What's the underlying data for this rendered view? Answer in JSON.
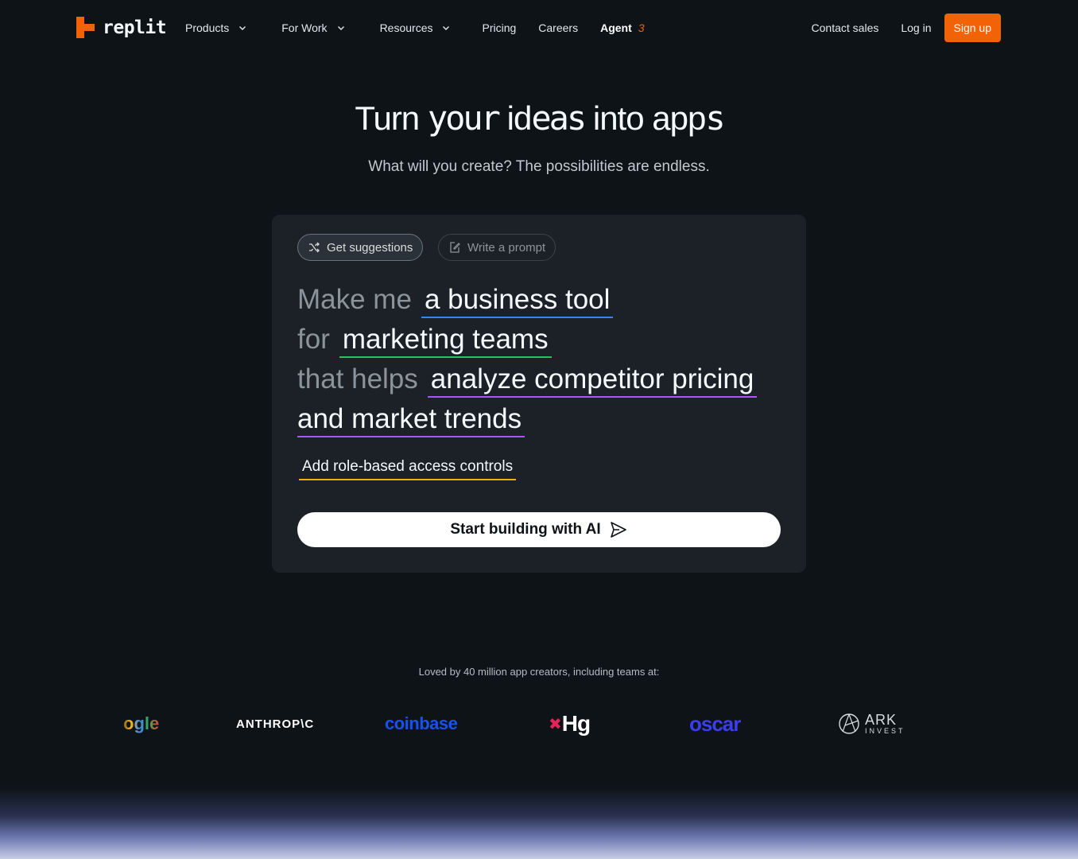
{
  "nav": {
    "logo_text": "replit",
    "brand_color": "#f26207",
    "items": [
      {
        "label": "Products",
        "dropdown": true
      },
      {
        "label": "For Work",
        "dropdown": true
      },
      {
        "label": "Resources",
        "dropdown": true
      },
      {
        "label": "Pricing",
        "dropdown": false
      },
      {
        "label": "Careers",
        "dropdown": false
      }
    ],
    "agent_label": "Agent",
    "agent_badge": "3",
    "contact_sales": "Contact sales",
    "login": "Log in",
    "signup": "Sign up"
  },
  "hero": {
    "title_a": "Turn ",
    "title_b": "your",
    "title_c": " id",
    "title_d": "eas",
    "title_e": " into app",
    "title_f": "s",
    "subtitle": "What will you create? The possibilities are endless."
  },
  "composer": {
    "suggestions_label": "Get suggestions",
    "write_prompt_label": "Write a prompt",
    "prompt": {
      "prefix1": "Make me",
      "value1": "a business tool",
      "prefix2": "for",
      "value2": "marketing teams",
      "prefix3": "that helps",
      "value3a": "analyze competitor pricing",
      "value3b": "and market trends"
    },
    "suggestion": "Add role-based access controls",
    "build_button": "Start building with AI"
  },
  "social_proof": {
    "text": "Loved by 40 million app creators, including teams at:",
    "logos": {
      "google": "ogle",
      "anthropic": "ANTHROP\\C",
      "coinbase": "coinbase",
      "hg": "Hg",
      "oscar": "oscar",
      "ark_1": "ARK",
      "ark_2": "INVEST"
    }
  }
}
